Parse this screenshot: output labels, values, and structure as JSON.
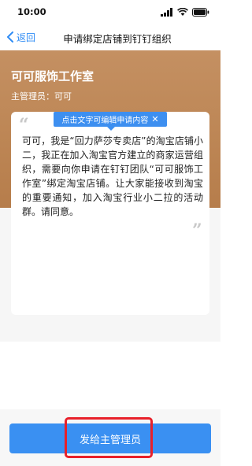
{
  "status_bar": {
    "time": "10:00",
    "icons": [
      "signal-icon",
      "wifi-icon",
      "battery-icon"
    ]
  },
  "nav": {
    "back_label": "返回",
    "title": "申请绑定店铺到钉钉组织"
  },
  "header": {
    "store_name": "可可服饰工作室",
    "admin_label": "主管理员：",
    "admin_name": "可可"
  },
  "tip": {
    "text": "点击文字可编辑申请内容",
    "close": "✕"
  },
  "message": {
    "body": "可可，我是“回力萨莎专卖店”的淘宝店铺小二，我正在加入淘宝官方建立的商家运营组织，需要向你申请在钉钉团队“可可服饰工作室”绑定淘宝店铺。让大家能接收到淘宝的重要通知，加入淘宝行业小二拉的活动群。请同意。"
  },
  "quotes": {
    "open": "“",
    "close": "”"
  },
  "actions": {
    "send_label": "发给主管理员"
  },
  "colors": {
    "accent": "#3a90f2",
    "header": "#bd8655",
    "highlight": "#e8202a"
  }
}
